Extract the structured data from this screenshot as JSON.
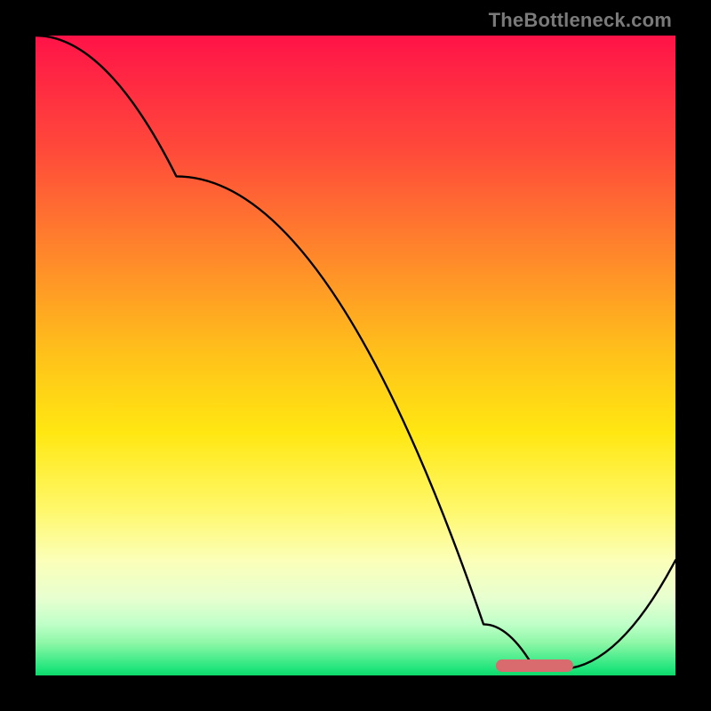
{
  "watermark": "TheBottleneck.com",
  "chart_data": {
    "type": "line",
    "title": "",
    "xlabel": "",
    "ylabel": "",
    "xlim": [
      0,
      100
    ],
    "ylim": [
      0,
      100
    ],
    "grid": false,
    "series": [
      {
        "name": "bottleneck-curve",
        "x": [
          0,
          22,
          70,
          78,
          82,
          100
        ],
        "y": [
          100,
          78,
          8,
          1,
          1,
          18
        ]
      }
    ],
    "optimal_zone": {
      "x_start": 72,
      "x_end": 84,
      "y": 1.5
    },
    "gradient_stops": [
      {
        "pos": 0,
        "color": "#ff1348"
      },
      {
        "pos": 18,
        "color": "#ff4a3a"
      },
      {
        "pos": 35,
        "color": "#ff8a2a"
      },
      {
        "pos": 50,
        "color": "#ffc21a"
      },
      {
        "pos": 62,
        "color": "#ffe712"
      },
      {
        "pos": 74,
        "color": "#fff86a"
      },
      {
        "pos": 82,
        "color": "#fbffb8"
      },
      {
        "pos": 88,
        "color": "#e7ffd0"
      },
      {
        "pos": 92,
        "color": "#bfffc8"
      },
      {
        "pos": 95,
        "color": "#8cf7a6"
      },
      {
        "pos": 99,
        "color": "#1fe57a"
      },
      {
        "pos": 100,
        "color": "#0fd86a"
      }
    ]
  }
}
